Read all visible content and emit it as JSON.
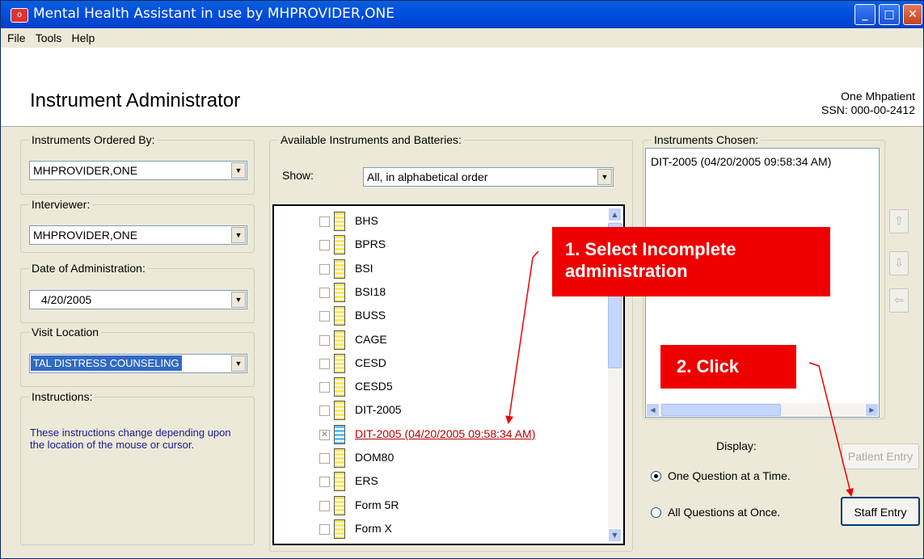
{
  "window": {
    "title": "Mental Health Assistant in use by MHPROVIDER,ONE",
    "app_icon_text": "o"
  },
  "menu": [
    "File",
    "Tools",
    "Help"
  ],
  "header": {
    "title": "Instrument Administrator",
    "patient_name": "One Mhpatient",
    "patient_ssn": "SSN: 000-00-2412"
  },
  "left": {
    "ordered_by_label": "Instruments Ordered By:",
    "ordered_by_value": "MHPROVIDER,ONE",
    "interviewer_label": "Interviewer:",
    "interviewer_value": "MHPROVIDER,ONE",
    "date_label": "Date of Administration:",
    "date_value": "4/20/2005",
    "location_label": "Visit Location",
    "location_value": "TAL DISTRESS COUNSELING",
    "instructions_label": "Instructions:",
    "instructions_text": "These instructions change depending upon the location of the mouse or cursor."
  },
  "middle": {
    "group_label": "Available Instruments and Batteries:",
    "show_label": "Show:",
    "show_value": "All, in alphabetical order",
    "items": [
      {
        "label": "BHS",
        "checked": false
      },
      {
        "label": "BPRS",
        "checked": false
      },
      {
        "label": "BSI",
        "checked": false
      },
      {
        "label": "BSI18",
        "checked": false
      },
      {
        "label": "BUSS",
        "checked": false
      },
      {
        "label": "CAGE",
        "checked": false
      },
      {
        "label": "CESD",
        "checked": false
      },
      {
        "label": "CESD5",
        "checked": false
      },
      {
        "label": "DIT-2005",
        "checked": false
      },
      {
        "label": "DIT-2005  (04/20/2005 09:58:34 AM)",
        "checked": true
      },
      {
        "label": "DOM80",
        "checked": false
      },
      {
        "label": "ERS",
        "checked": false
      },
      {
        "label": "Form 5R",
        "checked": false
      },
      {
        "label": "Form X",
        "checked": false
      }
    ]
  },
  "right": {
    "group_label": "Instruments Chosen:",
    "chosen_item": "DIT-2005  (04/20/2005 09:58:34 AM)",
    "display_label": "Display:",
    "radio_one": "One Question at a Time.",
    "radio_all": "All Questions at Once.",
    "patient_entry_label": "Patient Entry",
    "staff_entry_label": "Staff Entry"
  },
  "callouts": {
    "select": "1. Select Incomplete administration",
    "click": "2. Click"
  },
  "colors": {
    "callout": "#ee0000",
    "title_bar": "#0050e0",
    "instructions_text": "#1a1a8f",
    "selected_item": "#b00000"
  }
}
